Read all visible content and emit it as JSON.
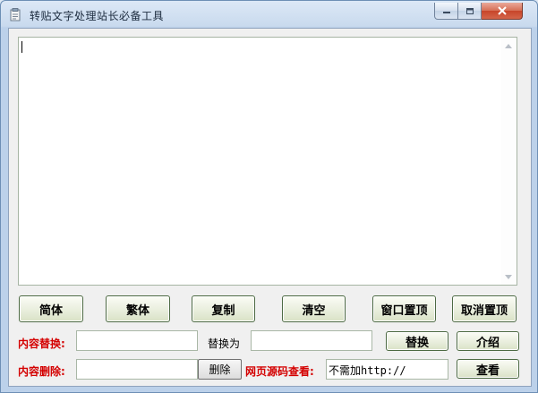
{
  "window": {
    "title": "转贴文字处理站长必备工具"
  },
  "editor": {
    "text": ""
  },
  "toolbar": {
    "simplified": "简体",
    "traditional": "繁体",
    "copy": "复制",
    "clear": "清空",
    "pin_top": "窗口置顶",
    "unpin_top": "取消置顶"
  },
  "replace_row": {
    "label": "内容替换:",
    "find_value": "",
    "replace_with_label": "替换为",
    "replace_value": "",
    "replace_button": "替换",
    "about_button": "介绍"
  },
  "delete_row": {
    "label": "内容删除:",
    "delete_value": "",
    "delete_button": "删除",
    "source_label": "网页源码查看:",
    "url_value": "不需加http://",
    "view_button": "查看"
  }
}
